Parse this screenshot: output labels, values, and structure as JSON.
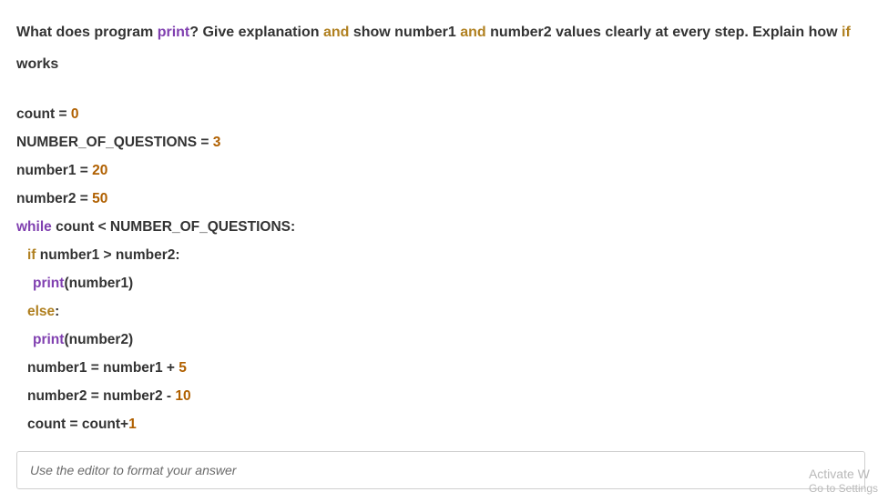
{
  "question": {
    "p1": "What does program ",
    "kw1": "print",
    "p2": "? Give explanation ",
    "kw2": "and",
    "p3": " show number1 ",
    "kw3": "and",
    "p4": " number2 values clearly at every step. Explain how ",
    "kw4": "if",
    "p5": " works"
  },
  "code": {
    "l1": {
      "a": "count = ",
      "n": "0"
    },
    "l2": {
      "a": "NUMBER_OF_QUESTIONS = ",
      "n": "3"
    },
    "l3": {
      "a": "number1 = ",
      "n": "20"
    },
    "l4": {
      "a": "number2 = ",
      "n": "50"
    },
    "l5": {
      "kw": "while",
      "a": " count < NUMBER_OF_QUESTIONS:"
    },
    "l6": {
      "kw": "if",
      "a": " number1 > number2:"
    },
    "l7": {
      "kw": "print",
      "a": "(number1)"
    },
    "l8": {
      "kw": "else",
      "a": ":"
    },
    "l9": {
      "kw": "print",
      "a": "(number2)"
    },
    "l10": {
      "a": "number1 = number1 + ",
      "n": "5"
    },
    "l11": {
      "a": "number2 = number2 - ",
      "n": "10"
    },
    "l12": {
      "a": "count = count+",
      "n": "1"
    }
  },
  "answer_placeholder": "Use the editor to format your answer",
  "watermark": {
    "line1": "Activate W",
    "line2": "Go to Settings"
  }
}
